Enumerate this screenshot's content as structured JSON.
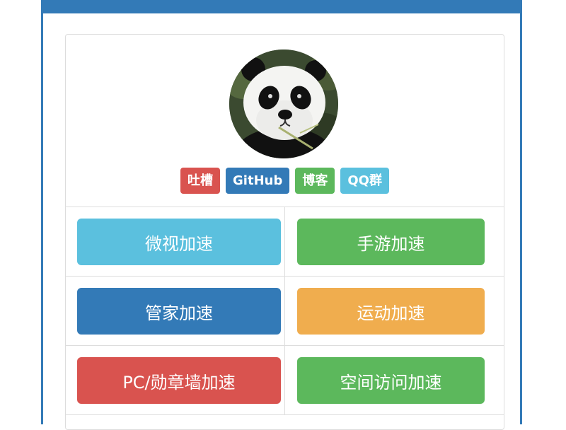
{
  "header": {
    "bar_color": "#337ab7"
  },
  "profile": {
    "avatar": "panda-avatar",
    "tags": [
      {
        "label": "吐槽",
        "color": "#d9534f"
      },
      {
        "label": "GitHub",
        "color": "#337ab7"
      },
      {
        "label": "博客",
        "color": "#5cb85c"
      },
      {
        "label": "QQ群",
        "color": "#5bc0de"
      }
    ]
  },
  "buttons": [
    {
      "label": "微视加速",
      "color": "#5bc0de"
    },
    {
      "label": "手游加速",
      "color": "#5cb85c"
    },
    {
      "label": "管家加速",
      "color": "#337ab7"
    },
    {
      "label": "运动加速",
      "color": "#f0ad4e"
    },
    {
      "label": "PC/勋章墙加速",
      "color": "#d9534f"
    },
    {
      "label": "空间访问加速",
      "color": "#5cb85c"
    }
  ]
}
